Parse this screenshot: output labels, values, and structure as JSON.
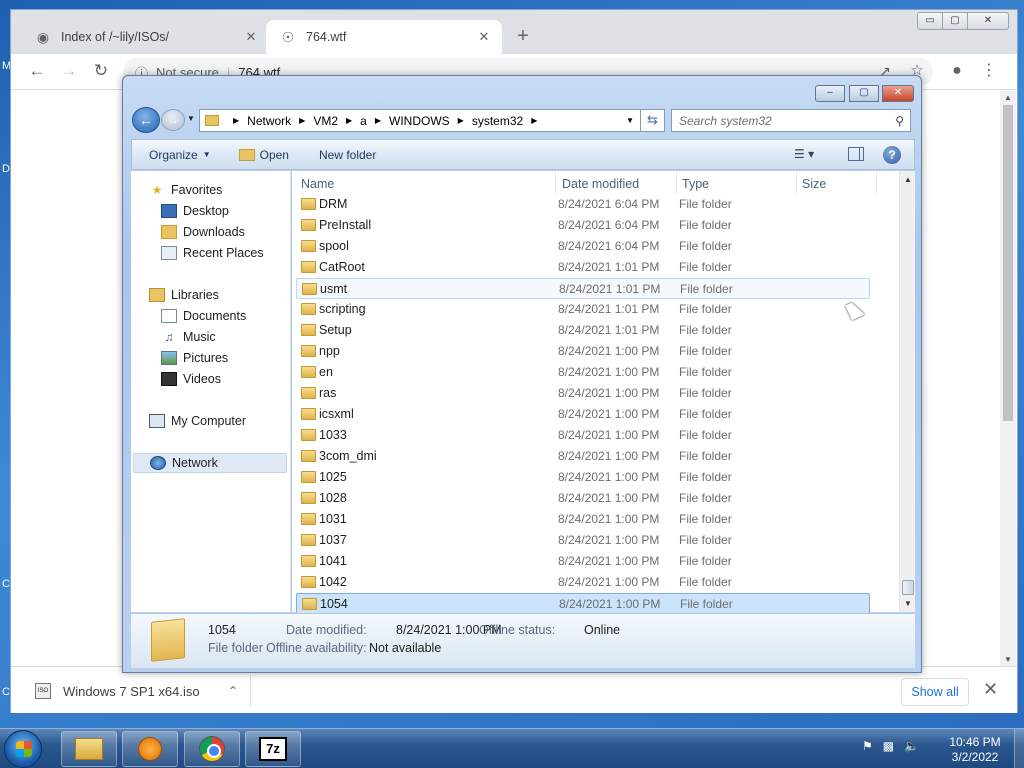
{
  "desktop": {
    "edge_letters": [
      "M",
      "D",
      "C",
      "C"
    ]
  },
  "chrome": {
    "tabs": [
      {
        "title": "Index of /~lily/ISOs/",
        "icon": "hat-icon"
      },
      {
        "title": "764.wtf",
        "icon": "globe-icon"
      }
    ],
    "new_tab": "+",
    "window_controls": {
      "minimize": "▭",
      "maximize": "▢",
      "close": "✕"
    },
    "omnibox": {
      "security": "Not secure",
      "separator": "|",
      "url": "764.wtf"
    },
    "download": {
      "filename": "Windows 7 SP1 x64.iso",
      "icon_text": "ISO",
      "show_all": "Show all",
      "close": "✕"
    }
  },
  "explorer": {
    "window_controls": {
      "minimize": "–",
      "maximize": "▢",
      "close": "✕"
    },
    "breadcrumb": [
      "Network",
      "VM2",
      "a",
      "WINDOWS",
      "system32"
    ],
    "search_placeholder": "Search system32",
    "commands": {
      "organize": "Organize",
      "open": "Open",
      "new_folder": "New folder"
    },
    "nav": {
      "favorites": {
        "label": "Favorites",
        "items": [
          "Desktop",
          "Downloads",
          "Recent Places"
        ]
      },
      "libraries": {
        "label": "Libraries",
        "items": [
          "Documents",
          "Music",
          "Pictures",
          "Videos"
        ]
      },
      "computer": "My Computer",
      "network": "Network"
    },
    "columns": {
      "name": "Name",
      "date": "Date modified",
      "type": "Type",
      "size": "Size"
    },
    "files": [
      {
        "name": "DRM",
        "date": "8/24/2021 6:04 PM",
        "type": "File folder"
      },
      {
        "name": "PreInstall",
        "date": "8/24/2021 6:04 PM",
        "type": "File folder"
      },
      {
        "name": "spool",
        "date": "8/24/2021 6:04 PM",
        "type": "File folder"
      },
      {
        "name": "CatRoot",
        "date": "8/24/2021 1:01 PM",
        "type": "File folder"
      },
      {
        "name": "usmt",
        "date": "8/24/2021 1:01 PM",
        "type": "File folder",
        "state": "hover"
      },
      {
        "name": "scripting",
        "date": "8/24/2021 1:01 PM",
        "type": "File folder"
      },
      {
        "name": "Setup",
        "date": "8/24/2021 1:01 PM",
        "type": "File folder"
      },
      {
        "name": "npp",
        "date": "8/24/2021 1:00 PM",
        "type": "File folder"
      },
      {
        "name": "en",
        "date": "8/24/2021 1:00 PM",
        "type": "File folder"
      },
      {
        "name": "ras",
        "date": "8/24/2021 1:00 PM",
        "type": "File folder"
      },
      {
        "name": "icsxml",
        "date": "8/24/2021 1:00 PM",
        "type": "File folder"
      },
      {
        "name": "1033",
        "date": "8/24/2021 1:00 PM",
        "type": "File folder"
      },
      {
        "name": "3com_dmi",
        "date": "8/24/2021 1:00 PM",
        "type": "File folder"
      },
      {
        "name": "1025",
        "date": "8/24/2021 1:00 PM",
        "type": "File folder"
      },
      {
        "name": "1028",
        "date": "8/24/2021 1:00 PM",
        "type": "File folder"
      },
      {
        "name": "1031",
        "date": "8/24/2021 1:00 PM",
        "type": "File folder"
      },
      {
        "name": "1037",
        "date": "8/24/2021 1:00 PM",
        "type": "File folder"
      },
      {
        "name": "1041",
        "date": "8/24/2021 1:00 PM",
        "type": "File folder"
      },
      {
        "name": "1042",
        "date": "8/24/2021 1:00 PM",
        "type": "File folder"
      },
      {
        "name": "1054",
        "date": "8/24/2021 1:00 PM",
        "type": "File folder",
        "state": "selected"
      }
    ],
    "details": {
      "name": "1054",
      "date_label": "Date modified:",
      "date_value": "8/24/2021 1:00 PM",
      "offline_status_label": "Offline status:",
      "offline_status_value": "Online",
      "type": "File folder",
      "offline_avail_label": "Offline availability:",
      "offline_avail_value": "Not available"
    }
  },
  "taskbar": {
    "seven_zip_label": "7z",
    "clock_time": "10:46 PM",
    "clock_date": "3/2/2022"
  }
}
